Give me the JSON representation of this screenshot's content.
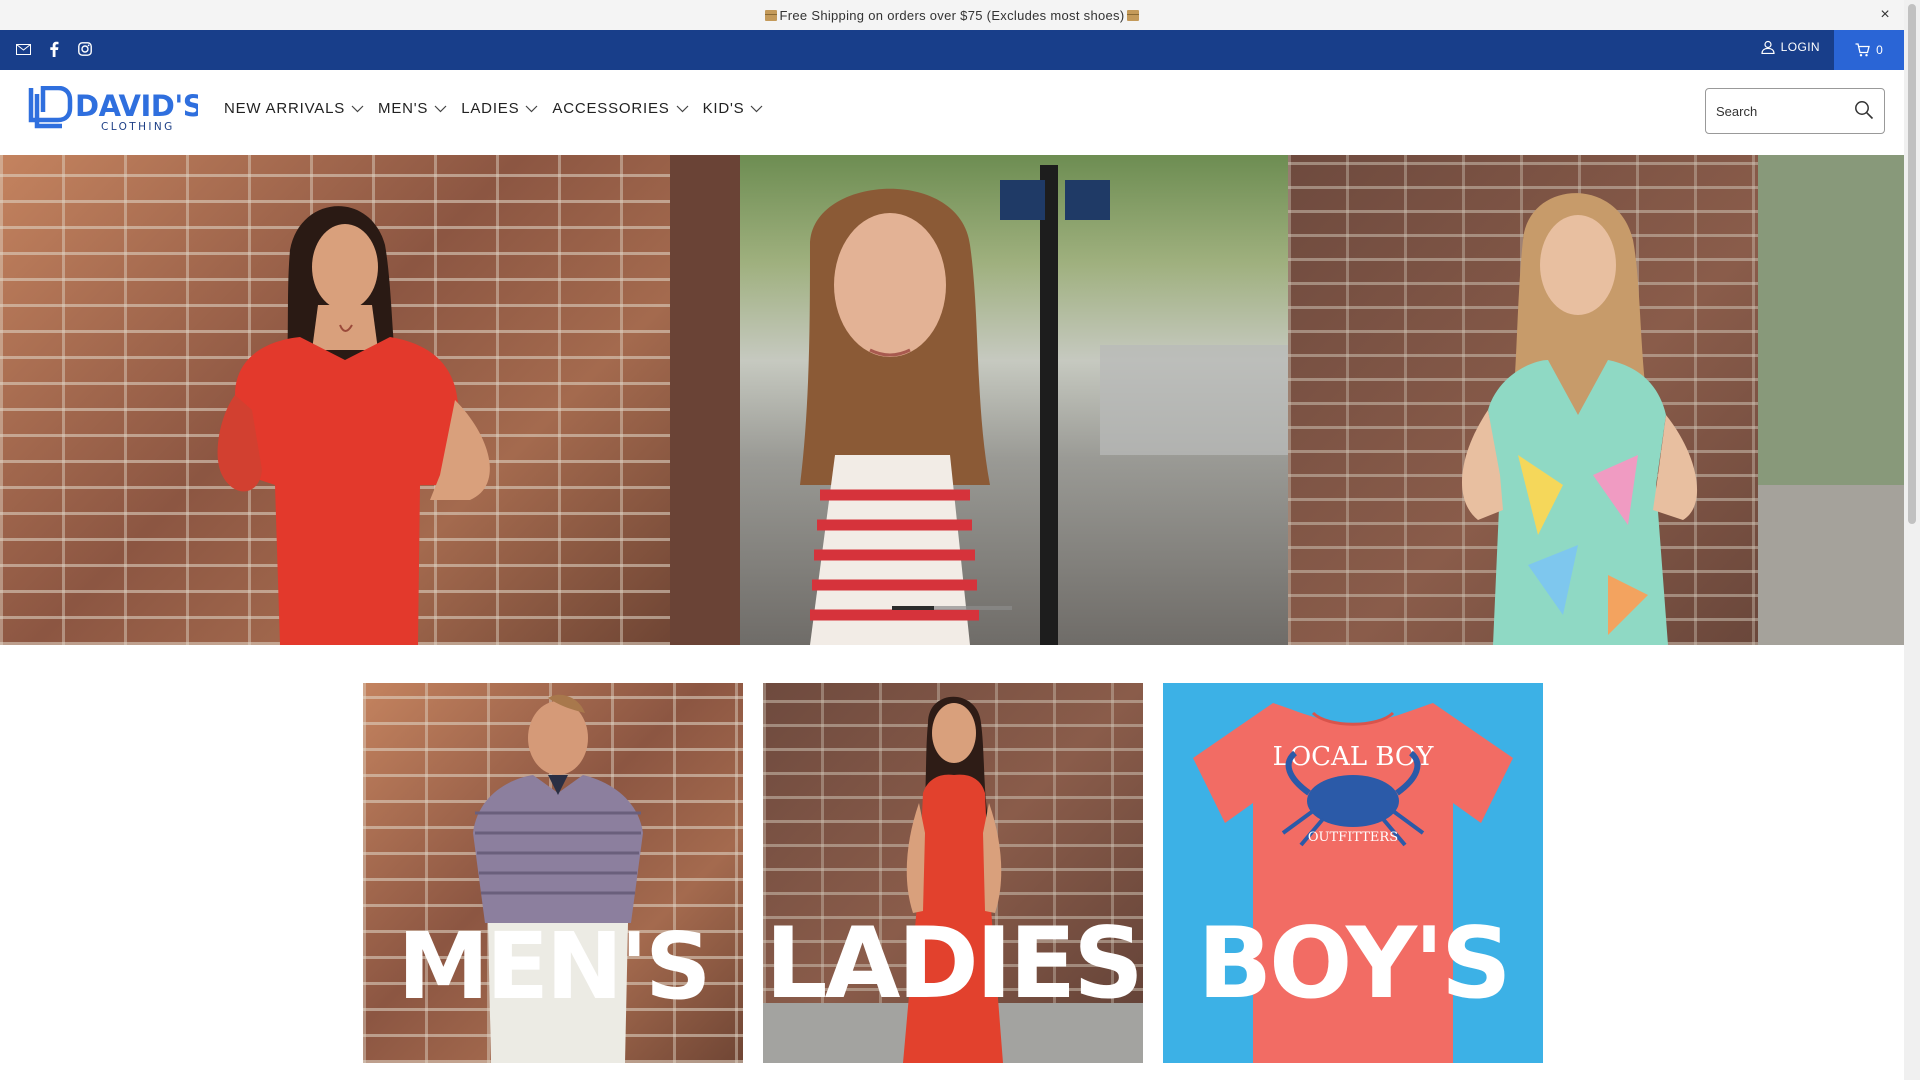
{
  "promo": {
    "text": "Free Shipping on orders over $75 (Excludes most shoes)",
    "close": "×"
  },
  "topbar": {
    "social": [
      "mail-icon",
      "facebook-icon",
      "instagram-icon"
    ],
    "login_label": "LOGIN",
    "cart_count": "0"
  },
  "header": {
    "logo_text": "DAVID'S",
    "logo_sub": "CLOTHING",
    "nav": [
      {
        "label": "NEW ARRIVALS"
      },
      {
        "label": "MEN'S"
      },
      {
        "label": "LADIES"
      },
      {
        "label": "ACCESSORIES"
      },
      {
        "label": "KID'S"
      }
    ],
    "search": {
      "placeholder": "Search"
    }
  },
  "hero": {
    "slides": 3,
    "active_slide": 1
  },
  "collections": [
    {
      "label": "MEN'S"
    },
    {
      "label": "LADIES"
    },
    {
      "label": "BOY'S",
      "shirt_text": "LOCAL BOY",
      "shirt_sub": "OUTFITTERS"
    }
  ],
  "colors": {
    "topbar": "#183e8a",
    "cart": "#2a65d6",
    "logo_blue": "#2f6fde",
    "boys_tile": "#3cb1e6",
    "shirt": "#f26c64"
  }
}
